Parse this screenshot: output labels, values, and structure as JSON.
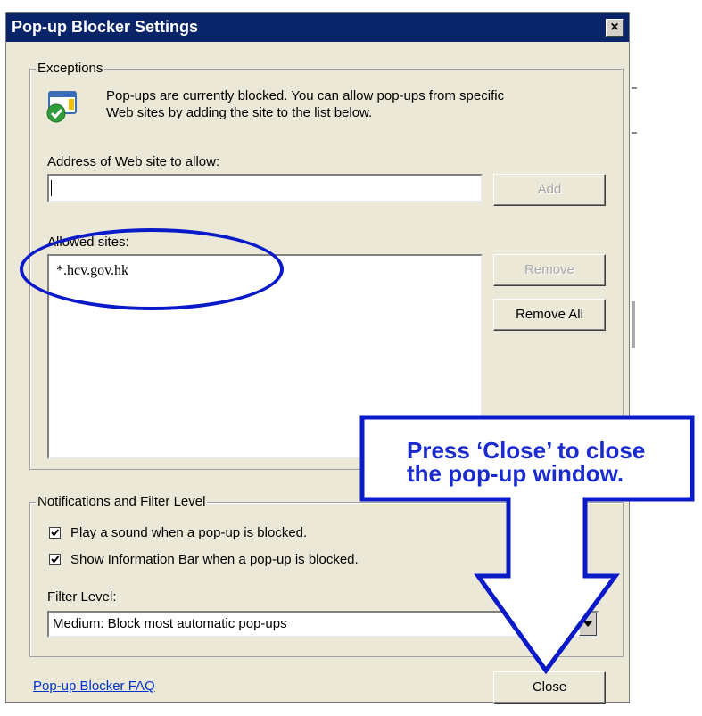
{
  "window": {
    "title": "Pop-up Blocker Settings",
    "close_glyph": "×"
  },
  "exceptions": {
    "legend": "Exceptions",
    "message_line1": "Pop-ups are currently blocked.  You can allow pop-ups from specific",
    "message_line2": "Web sites by adding the site to the list below.",
    "address_label": "Address of Web site to allow:",
    "address_value": "",
    "add_label": "Add",
    "allowed_label": "Allowed sites:",
    "allowed_sites": [
      "*.hcv.gov.hk"
    ],
    "remove_label": "Remove",
    "remove_all_label": "Remove All"
  },
  "notifications": {
    "legend": "Notifications and Filter Level",
    "play_sound_label": "Play a sound when a pop-up is blocked.",
    "play_sound_checked": true,
    "info_bar_label": "Show Information Bar when a pop-up is blocked.",
    "info_bar_checked": true,
    "filter_label": "Filter Level:",
    "filter_value": "Medium: Block most automatic pop-ups"
  },
  "footer": {
    "faq_link": "Pop-up Blocker FAQ",
    "close_label": "Close"
  },
  "annotation": {
    "callout_line1": "Press ‘Close’ to close",
    "callout_line2": "the pop-up window.",
    "color": "#0a1ac8"
  },
  "icons": {
    "info": "popup-shield-icon",
    "check": "checkmark-icon",
    "dropdown": "chevron-down-icon"
  }
}
